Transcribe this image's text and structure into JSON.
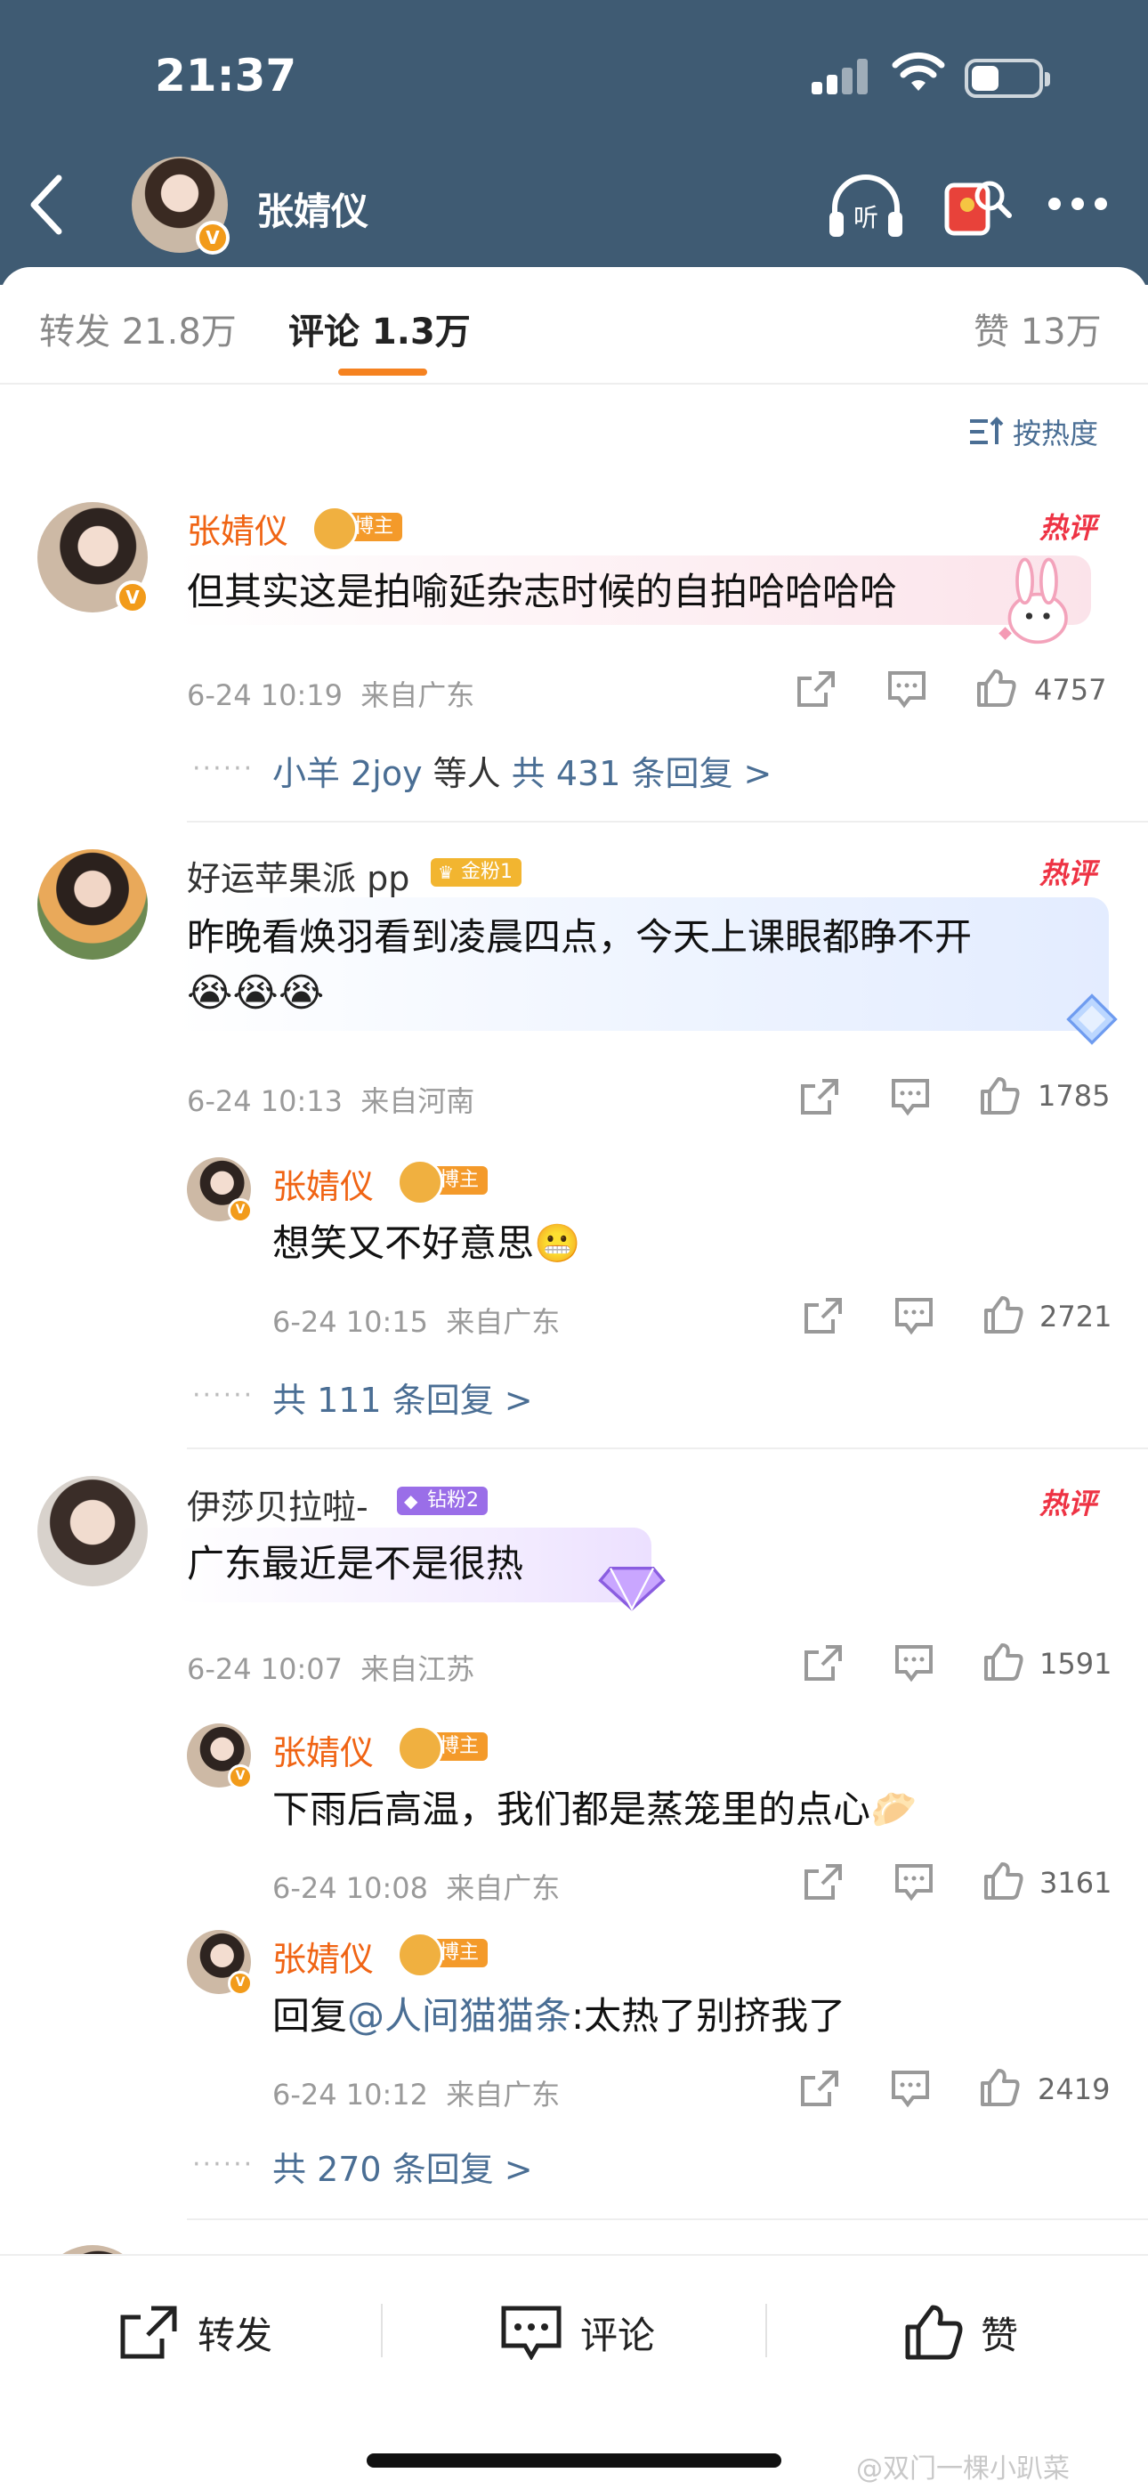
{
  "status": {
    "time": "21:37"
  },
  "header": {
    "title": "张婧仪"
  },
  "tabs": [
    {
      "label": "转发 21.8万"
    },
    {
      "label": "评论 1.3万"
    },
    {
      "label": "赞 13万"
    }
  ],
  "sort": {
    "label": "按热度"
  },
  "comments": [
    {
      "user": "张婧仪",
      "tag": "博主",
      "hot": "热评",
      "text": "但其实这是拍喻延杂志时候的自拍哈哈哈哈",
      "time": "6-24 10:19",
      "location": "来自广东",
      "likes": "4757",
      "replies_summary": {
        "users": "小羊 2joy",
        "middle": "等人",
        "count": "共 431 条回复 >"
      }
    },
    {
      "user": "好运苹果派 pp",
      "tag": "金粉1",
      "hot": "热评",
      "text": "昨晚看焕羽看到凌晨四点，今天上课眼都睁不开",
      "emoji": "😭😭😭",
      "time": "6-24 10:13",
      "location": "来自河南",
      "likes": "1785",
      "reply": {
        "user": "张婧仪",
        "tag": "博主",
        "text": "想笑又不好意思",
        "emoji": "😬",
        "time": "6-24 10:15",
        "location": "来自广东",
        "likes": "2721"
      },
      "more": "共 111 条回复 >"
    },
    {
      "user": "伊莎贝拉啦-",
      "tag": "钻粉2",
      "hot": "热评",
      "text": "广东最近是不是很热",
      "time": "6-24 10:07",
      "location": "来自江苏",
      "likes": "1591",
      "replies": [
        {
          "user": "张婧仪",
          "tag": "博主",
          "text": "下雨后高温，我们都是蒸笼里的点心",
          "emoji": "🥟",
          "time": "6-24 10:08",
          "location": "来自广东",
          "likes": "3161"
        },
        {
          "user": "张婧仪",
          "tag": "博主",
          "prefix": "回复",
          "mention": "@人间猫猫条",
          "suffix": ":太热了别挤我了",
          "time": "6-24 10:12",
          "location": "来自广东",
          "likes": "2419"
        }
      ],
      "more": "共 270 条回复 >"
    }
  ],
  "bottom": {
    "repost": "转发",
    "comment": "评论",
    "like": "赞"
  },
  "watermark": "@双门一棵小趴菜",
  "colors": {
    "header_bg": "#3f5b73",
    "accent_orange": "#f58220",
    "link_blue": "#4a6e94",
    "hot_red": "#ee3344"
  }
}
